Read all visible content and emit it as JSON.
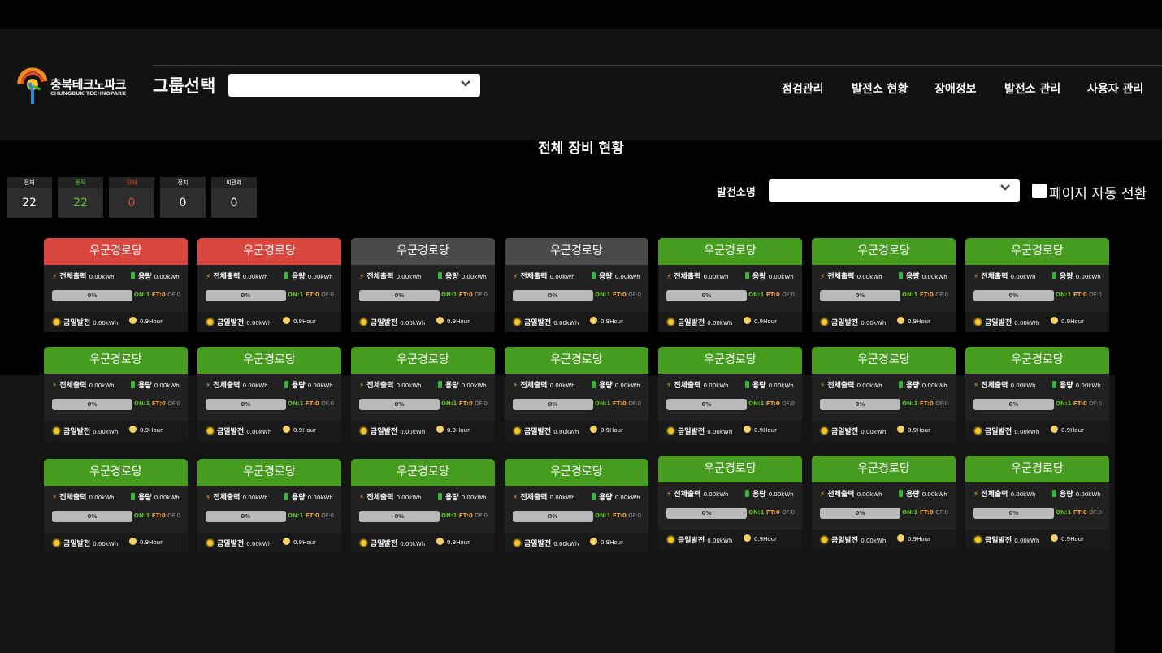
{
  "header": {
    "logo_text": "충북테크노파크",
    "logo_sub": "CHUNGBUK TECHNOPARK",
    "group_label": "그룹선택",
    "group_value": "",
    "nav": [
      "점검관리",
      "발전소 현황",
      "장애정보",
      "발전소 관리",
      "사용자 관리"
    ]
  },
  "page_title": "전체 장비 현황",
  "stats": [
    {
      "label": "전체",
      "value": "22",
      "color": "#ffffff"
    },
    {
      "label": "동작",
      "value": "22",
      "color": "#6ac23a"
    },
    {
      "label": "장애",
      "value": "0",
      "color": "#e0453c"
    },
    {
      "label": "정지",
      "value": "0",
      "color": "#ffffff"
    },
    {
      "label": "미관제",
      "value": "0",
      "color": "#ffffff"
    }
  ],
  "filter": {
    "plant_label": "발전소명",
    "plant_value": "",
    "auto_label": "페이지 자동 전환",
    "auto_checked": false
  },
  "card_labels": {
    "total_output": "전체출력",
    "capacity": "용량",
    "today_gen": "금일발전"
  },
  "colors": {
    "red": "#d9463e",
    "gray": "#4a4a4a",
    "green": "#469c1e"
  },
  "cards": [
    {
      "name": "우군경로당",
      "status": "red",
      "output": "0.00kWh",
      "capacity": "0.00kWh",
      "percent": "0%",
      "on": "ON:1",
      "ft": "FT:0",
      "of": "OF:0",
      "today": "0.00kWh",
      "hours": "0.9Hour"
    },
    {
      "name": "우군경로당",
      "status": "red",
      "output": "0.00kWh",
      "capacity": "0.00kWh",
      "percent": "0%",
      "on": "ON:1",
      "ft": "FT:0",
      "of": "OF:0",
      "today": "0.00kWh",
      "hours": "0.9Hour"
    },
    {
      "name": "우군경로당",
      "status": "gray",
      "output": "0.00kWh",
      "capacity": "0.00kWh",
      "percent": "0%",
      "on": "ON:1",
      "ft": "FT:0",
      "of": "OF:0",
      "today": "0.00kWh",
      "hours": "0.9Hour"
    },
    {
      "name": "우군경로당",
      "status": "gray",
      "output": "0.00kWh",
      "capacity": "0.00kWh",
      "percent": "0%",
      "on": "ON:1",
      "ft": "FT:0",
      "of": "OF:0",
      "today": "0.00kWh",
      "hours": "0.9Hour"
    },
    {
      "name": "우군경로당",
      "status": "green",
      "output": "0.00kWh",
      "capacity": "0.00kWh",
      "percent": "0%",
      "on": "ON:1",
      "ft": "FT:0",
      "of": "OF:0",
      "today": "0.00kWh",
      "hours": "0.9Hour"
    },
    {
      "name": "우군경로당",
      "status": "green",
      "output": "0.00kWh",
      "capacity": "0.00kWh",
      "percent": "0%",
      "on": "ON:1",
      "ft": "FT:0",
      "of": "OF:0",
      "today": "0.00kWh",
      "hours": "0.9Hour"
    },
    {
      "name": "우군경로당",
      "status": "green",
      "output": "0.00kWh",
      "capacity": "0.00kWh",
      "percent": "0%",
      "on": "ON:1",
      "ft": "FT:0",
      "of": "OF:0",
      "today": "0.00kWh",
      "hours": "0.9Hour"
    },
    {
      "name": "우군경로당",
      "status": "green",
      "output": "0.00kWh",
      "capacity": "0.00kWh",
      "percent": "0%",
      "on": "ON:1",
      "ft": "FT:0",
      "of": "OF:0",
      "today": "0.00kWh",
      "hours": "0.9Hour"
    },
    {
      "name": "우군경로당",
      "status": "green",
      "output": "0.00kWh",
      "capacity": "0.00kWh",
      "percent": "0%",
      "on": "ON:1",
      "ft": "FT:0",
      "of": "OF:0",
      "today": "0.00kWh",
      "hours": "0.9Hour"
    },
    {
      "name": "우군경로당",
      "status": "green",
      "output": "0.00kWh",
      "capacity": "0.00kWh",
      "percent": "0%",
      "on": "ON:1",
      "ft": "FT:0",
      "of": "OF:0",
      "today": "0.00kWh",
      "hours": "0.9Hour"
    },
    {
      "name": "우군경로당",
      "status": "green",
      "output": "0.00kWh",
      "capacity": "0.00kWh",
      "percent": "0%",
      "on": "ON:1",
      "ft": "FT:0",
      "of": "OF:0",
      "today": "0.00kWh",
      "hours": "0.9Hour"
    },
    {
      "name": "우군경로당",
      "status": "green",
      "output": "0.00kWh",
      "capacity": "0.00kWh",
      "percent": "0%",
      "on": "ON:1",
      "ft": "FT:0",
      "of": "OF:0",
      "today": "0.00kWh",
      "hours": "0.9Hour"
    },
    {
      "name": "우군경로당",
      "status": "green",
      "output": "0.00kWh",
      "capacity": "0.00kWh",
      "percent": "0%",
      "on": "ON:1",
      "ft": "FT:0",
      "of": "OF:0",
      "today": "0.00kWh",
      "hours": "0.9Hour"
    },
    {
      "name": "우군경로당",
      "status": "green",
      "output": "0.00kWh",
      "capacity": "0.00kWh",
      "percent": "0%",
      "on": "ON:1",
      "ft": "FT:0",
      "of": "OF:0",
      "today": "0.00kWh",
      "hours": "0.9Hour"
    },
    {
      "name": "우군경로당",
      "status": "green",
      "output": "0.00kWh",
      "capacity": "0.00kWh",
      "percent": "0%",
      "on": "ON:1",
      "ft": "FT:0",
      "of": "OF:0",
      "today": "0.00kWh",
      "hours": "0.9Hour"
    },
    {
      "name": "우군경로당",
      "status": "green",
      "output": "0.00kWh",
      "capacity": "0.00kWh",
      "percent": "0%",
      "on": "ON:1",
      "ft": "FT:0",
      "of": "OF:0",
      "today": "0.00kWh",
      "hours": "0.9Hour"
    },
    {
      "name": "우군경로당",
      "status": "green",
      "output": "0.00kWh",
      "capacity": "0.00kWh",
      "percent": "0%",
      "on": "ON:1",
      "ft": "FT:0",
      "of": "OF:0",
      "today": "0.00kWh",
      "hours": "0.9Hour"
    },
    {
      "name": "우군경로당",
      "status": "green",
      "output": "0.00kWh",
      "capacity": "0.00kWh",
      "percent": "0%",
      "on": "ON:1",
      "ft": "FT:0",
      "of": "OF:0",
      "today": "0.00kWh",
      "hours": "0.9Hour"
    },
    {
      "name": "우군경로당",
      "status": "green",
      "output": "0.00kWh",
      "capacity": "0.00kWh",
      "percent": "0%",
      "on": "ON:1",
      "ft": "FT:0",
      "of": "OF:0",
      "today": "0.00kWh",
      "hours": "0.9Hour"
    },
    {
      "name": "우군경로당",
      "status": "green",
      "output": "0.00kWh",
      "capacity": "0.00kWh",
      "percent": "0%",
      "on": "ON:1",
      "ft": "FT:0",
      "of": "OF:0",
      "today": "0.00kWh",
      "hours": "0.9Hour"
    },
    {
      "name": "우군경로당",
      "status": "green",
      "output": "0.00kWh",
      "capacity": "0.00kWh",
      "percent": "0%",
      "on": "ON:1",
      "ft": "FT:0",
      "of": "OF:0",
      "today": "0.00kWh",
      "hours": "0.9Hour"
    }
  ]
}
